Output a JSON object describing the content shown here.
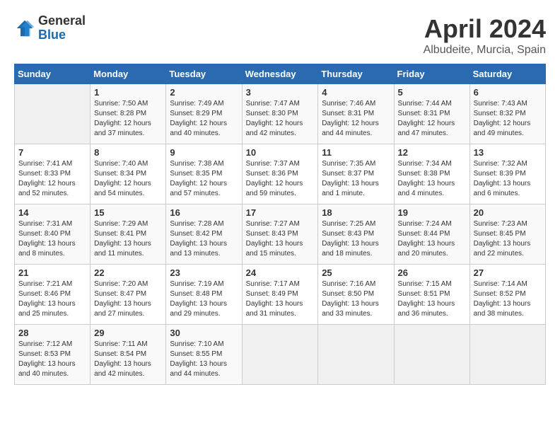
{
  "header": {
    "logo_general": "General",
    "logo_blue": "Blue",
    "title": "April 2024",
    "location": "Albudeite, Murcia, Spain"
  },
  "weekdays": [
    "Sunday",
    "Monday",
    "Tuesday",
    "Wednesday",
    "Thursday",
    "Friday",
    "Saturday"
  ],
  "weeks": [
    [
      {
        "num": "",
        "info": ""
      },
      {
        "num": "1",
        "info": "Sunrise: 7:50 AM\nSunset: 8:28 PM\nDaylight: 12 hours\nand 37 minutes."
      },
      {
        "num": "2",
        "info": "Sunrise: 7:49 AM\nSunset: 8:29 PM\nDaylight: 12 hours\nand 40 minutes."
      },
      {
        "num": "3",
        "info": "Sunrise: 7:47 AM\nSunset: 8:30 PM\nDaylight: 12 hours\nand 42 minutes."
      },
      {
        "num": "4",
        "info": "Sunrise: 7:46 AM\nSunset: 8:31 PM\nDaylight: 12 hours\nand 44 minutes."
      },
      {
        "num": "5",
        "info": "Sunrise: 7:44 AM\nSunset: 8:31 PM\nDaylight: 12 hours\nand 47 minutes."
      },
      {
        "num": "6",
        "info": "Sunrise: 7:43 AM\nSunset: 8:32 PM\nDaylight: 12 hours\nand 49 minutes."
      }
    ],
    [
      {
        "num": "7",
        "info": "Sunrise: 7:41 AM\nSunset: 8:33 PM\nDaylight: 12 hours\nand 52 minutes."
      },
      {
        "num": "8",
        "info": "Sunrise: 7:40 AM\nSunset: 8:34 PM\nDaylight: 12 hours\nand 54 minutes."
      },
      {
        "num": "9",
        "info": "Sunrise: 7:38 AM\nSunset: 8:35 PM\nDaylight: 12 hours\nand 57 minutes."
      },
      {
        "num": "10",
        "info": "Sunrise: 7:37 AM\nSunset: 8:36 PM\nDaylight: 12 hours\nand 59 minutes."
      },
      {
        "num": "11",
        "info": "Sunrise: 7:35 AM\nSunset: 8:37 PM\nDaylight: 13 hours\nand 1 minute."
      },
      {
        "num": "12",
        "info": "Sunrise: 7:34 AM\nSunset: 8:38 PM\nDaylight: 13 hours\nand 4 minutes."
      },
      {
        "num": "13",
        "info": "Sunrise: 7:32 AM\nSunset: 8:39 PM\nDaylight: 13 hours\nand 6 minutes."
      }
    ],
    [
      {
        "num": "14",
        "info": "Sunrise: 7:31 AM\nSunset: 8:40 PM\nDaylight: 13 hours\nand 8 minutes."
      },
      {
        "num": "15",
        "info": "Sunrise: 7:29 AM\nSunset: 8:41 PM\nDaylight: 13 hours\nand 11 minutes."
      },
      {
        "num": "16",
        "info": "Sunrise: 7:28 AM\nSunset: 8:42 PM\nDaylight: 13 hours\nand 13 minutes."
      },
      {
        "num": "17",
        "info": "Sunrise: 7:27 AM\nSunset: 8:43 PM\nDaylight: 13 hours\nand 15 minutes."
      },
      {
        "num": "18",
        "info": "Sunrise: 7:25 AM\nSunset: 8:43 PM\nDaylight: 13 hours\nand 18 minutes."
      },
      {
        "num": "19",
        "info": "Sunrise: 7:24 AM\nSunset: 8:44 PM\nDaylight: 13 hours\nand 20 minutes."
      },
      {
        "num": "20",
        "info": "Sunrise: 7:23 AM\nSunset: 8:45 PM\nDaylight: 13 hours\nand 22 minutes."
      }
    ],
    [
      {
        "num": "21",
        "info": "Sunrise: 7:21 AM\nSunset: 8:46 PM\nDaylight: 13 hours\nand 25 minutes."
      },
      {
        "num": "22",
        "info": "Sunrise: 7:20 AM\nSunset: 8:47 PM\nDaylight: 13 hours\nand 27 minutes."
      },
      {
        "num": "23",
        "info": "Sunrise: 7:19 AM\nSunset: 8:48 PM\nDaylight: 13 hours\nand 29 minutes."
      },
      {
        "num": "24",
        "info": "Sunrise: 7:17 AM\nSunset: 8:49 PM\nDaylight: 13 hours\nand 31 minutes."
      },
      {
        "num": "25",
        "info": "Sunrise: 7:16 AM\nSunset: 8:50 PM\nDaylight: 13 hours\nand 33 minutes."
      },
      {
        "num": "26",
        "info": "Sunrise: 7:15 AM\nSunset: 8:51 PM\nDaylight: 13 hours\nand 36 minutes."
      },
      {
        "num": "27",
        "info": "Sunrise: 7:14 AM\nSunset: 8:52 PM\nDaylight: 13 hours\nand 38 minutes."
      }
    ],
    [
      {
        "num": "28",
        "info": "Sunrise: 7:12 AM\nSunset: 8:53 PM\nDaylight: 13 hours\nand 40 minutes."
      },
      {
        "num": "29",
        "info": "Sunrise: 7:11 AM\nSunset: 8:54 PM\nDaylight: 13 hours\nand 42 minutes."
      },
      {
        "num": "30",
        "info": "Sunrise: 7:10 AM\nSunset: 8:55 PM\nDaylight: 13 hours\nand 44 minutes."
      },
      {
        "num": "",
        "info": ""
      },
      {
        "num": "",
        "info": ""
      },
      {
        "num": "",
        "info": ""
      },
      {
        "num": "",
        "info": ""
      }
    ]
  ]
}
